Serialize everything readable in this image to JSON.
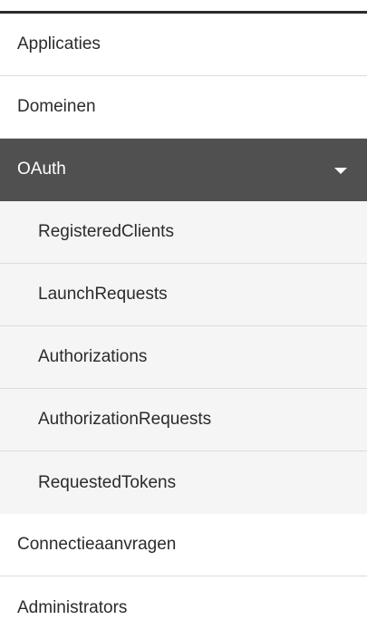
{
  "menu": {
    "items": [
      {
        "label": "Applicaties"
      },
      {
        "label": "Domeinen"
      },
      {
        "label": "OAuth",
        "expanded": true
      },
      {
        "label": "Connectieaanvragen"
      },
      {
        "label": "Administrators"
      }
    ],
    "oauth_children": [
      {
        "label": "RegisteredClients"
      },
      {
        "label": "LaunchRequests"
      },
      {
        "label": "Authorizations"
      },
      {
        "label": "AuthorizationRequests"
      },
      {
        "label": "RequestedTokens"
      }
    ]
  },
  "icons": {
    "oauth_toggle": "caret-down-icon"
  },
  "colors": {
    "active_group_background": "#505050",
    "submenu_background": "#f5f5f5",
    "text": "#2b2b2b"
  }
}
